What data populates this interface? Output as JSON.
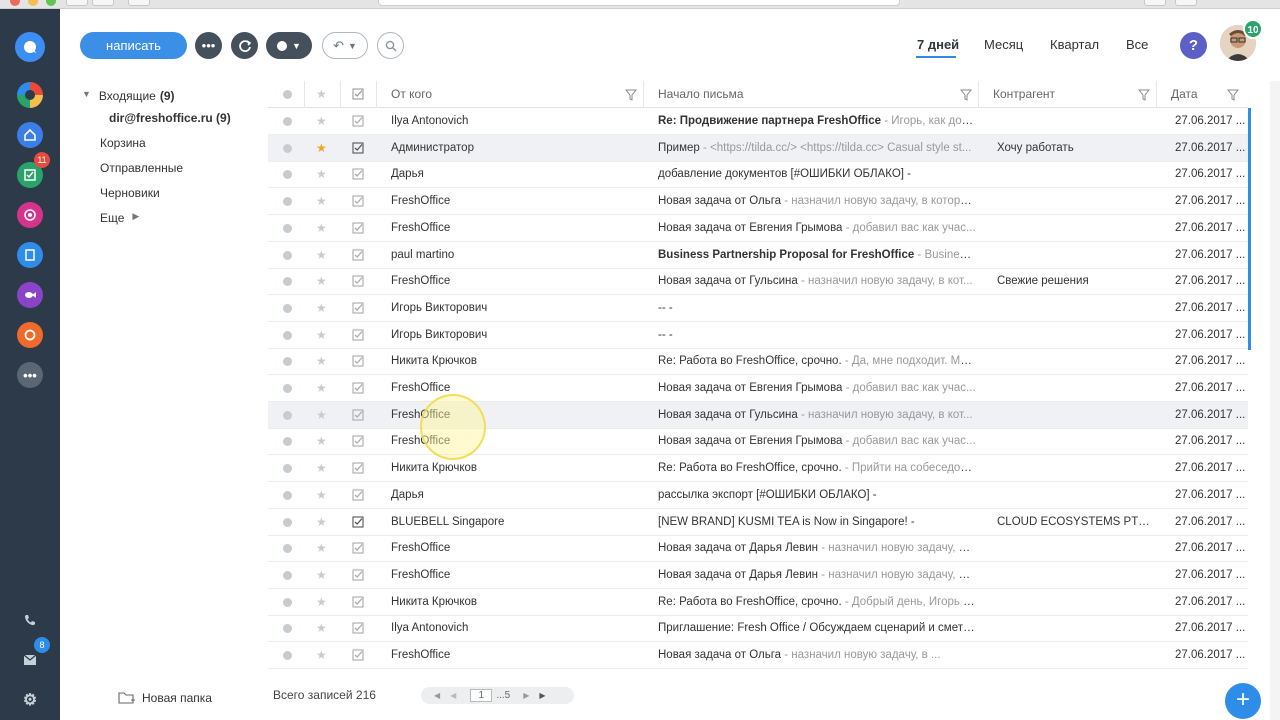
{
  "toolbar": {
    "compose_label": "написать",
    "periods": [
      "7 дней",
      "Месяц",
      "Квартал",
      "Все"
    ],
    "active_period": "7 дней",
    "help_label": "?",
    "avatar_badge": "10"
  },
  "rail": {
    "badges": {
      "tasks": "11",
      "mail": "8"
    }
  },
  "folders": {
    "inbox_label": "Входящие",
    "inbox_count": "(9)",
    "account": "dir@freshoffice.ru (9)",
    "trash": "Корзина",
    "sent": "Отправленные",
    "drafts": "Черновики",
    "more": "Еще",
    "new_folder": "Новая папка"
  },
  "table": {
    "headers": {
      "from": "От кого",
      "subject": "Начало письма",
      "contractor": "Контрагент",
      "date": "Дата"
    },
    "rows": [
      {
        "from": "Ilya Antonovich",
        "subject": "Re: Продвижение партнера FreshOffice",
        "preview": " - Игорь, как догов...",
        "contractor": "",
        "date": "27.06.2017 ...",
        "bold": true,
        "starred": false,
        "highlight": false,
        "checked": false
      },
      {
        "from": "Администратор",
        "subject": "Пример",
        "preview": " - <https://tilda.cc/> <https://tilda.cc> Casual style st...",
        "contractor": "Хочу работать",
        "date": "27.06.2017 ...",
        "bold": false,
        "starred": true,
        "highlight": true,
        "checked": true
      },
      {
        "from": "Дарья",
        "subject": "добавление документов [#ОШИБКИ ОБЛАКО] -",
        "preview": "",
        "contractor": "",
        "date": "27.06.2017 ...",
        "bold": false,
        "starred": false,
        "highlight": false,
        "checked": false
      },
      {
        "from": "FreshOffice",
        "subject": "Новая задача от Ольга",
        "preview": " - назначил новую задачу, в которо...",
        "contractor": "",
        "date": "27.06.2017 ...",
        "bold": false,
        "starred": false,
        "highlight": false,
        "checked": false
      },
      {
        "from": "FreshOffice",
        "subject": "Новая задача от Евгения Грымова",
        "preview": " - добавил вас как учас...",
        "contractor": "",
        "date": "27.06.2017 ...",
        "bold": false,
        "starred": false,
        "highlight": false,
        "checked": false
      },
      {
        "from": "paul martino",
        "subject": "Business Partnership Proposal for FreshOffice",
        "preview": " - Business P...",
        "contractor": "",
        "date": "27.06.2017 ...",
        "bold": true,
        "starred": false,
        "highlight": false,
        "checked": false
      },
      {
        "from": "FreshOffice",
        "subject": "Новая задача от Гульсина",
        "preview": " - назначил новую задачу, в кот...",
        "contractor": "Свежие решения",
        "date": "27.06.2017 ...",
        "bold": false,
        "starred": false,
        "highlight": false,
        "checked": false
      },
      {
        "from": "Игорь Викторович",
        "subject": "-- -",
        "preview": "",
        "contractor": "",
        "date": "27.06.2017 ...",
        "bold": false,
        "starred": false,
        "highlight": false,
        "checked": false
      },
      {
        "from": "Игорь Викторович",
        "subject": "-- -",
        "preview": "",
        "contractor": "",
        "date": "27.06.2017 ...",
        "bold": false,
        "starred": false,
        "highlight": false,
        "checked": false
      },
      {
        "from": "Никита Крючков",
        "subject": "Re: Работа во FreshOffice, срочно.",
        "preview": " - Да, мне подходит. Мой...",
        "contractor": "",
        "date": "27.06.2017 ...",
        "bold": false,
        "starred": false,
        "highlight": false,
        "checked": false
      },
      {
        "from": "FreshOffice",
        "subject": "Новая задача от Евгения Грымова",
        "preview": " - добавил вас как учас...",
        "contractor": "",
        "date": "27.06.2017 ...",
        "bold": false,
        "starred": false,
        "highlight": false,
        "checked": false
      },
      {
        "from": "FreshOffice",
        "subject": "Новая задача от Гульсина",
        "preview": " - назначил новую задачу, в кот...",
        "contractor": "",
        "date": "27.06.2017 ...",
        "bold": false,
        "starred": false,
        "highlight": true,
        "checked": false
      },
      {
        "from": "FreshOffice",
        "subject": "Новая задача от Евгения Грымова",
        "preview": " - добавил вас как учас...",
        "contractor": "",
        "date": "27.06.2017 ...",
        "bold": false,
        "starred": false,
        "highlight": false,
        "checked": false
      },
      {
        "from": "Никита Крючков",
        "subject": "Re: Работа во FreshOffice, срочно.",
        "preview": " - Прийти на собеседова...",
        "contractor": "",
        "date": "27.06.2017 ...",
        "bold": false,
        "starred": false,
        "highlight": false,
        "checked": false
      },
      {
        "from": "Дарья",
        "subject": "рассылка экспорт [#ОШИБКИ ОБЛАКО] -",
        "preview": "",
        "contractor": "",
        "date": "27.06.2017 ...",
        "bold": false,
        "starred": false,
        "highlight": false,
        "checked": false
      },
      {
        "from": "BLUEBELL Singapore",
        "subject": "[NEW BRAND] KUSMI TEA is Now in Singapore! -",
        "preview": "",
        "contractor": "CLOUD ECOSYSTEMS PTE LT...",
        "date": "27.06.2017 ...",
        "bold": false,
        "starred": false,
        "highlight": false,
        "checked": true
      },
      {
        "from": "FreshOffice",
        "subject": "Новая задача от Дарья Левин",
        "preview": " - назначил новую задачу, в ...",
        "contractor": "",
        "date": "27.06.2017 ...",
        "bold": false,
        "starred": false,
        "highlight": false,
        "checked": false
      },
      {
        "from": "FreshOffice",
        "subject": "Новая задача от Дарья Левин",
        "preview": " - назначил новую задачу, в ...",
        "contractor": "",
        "date": "27.06.2017 ...",
        "bold": false,
        "starred": false,
        "highlight": false,
        "checked": false
      },
      {
        "from": "Никита Крючков",
        "subject": "Re: Работа во FreshOffice, срочно.",
        "preview": " - Добрый день, Игорь В...",
        "contractor": "",
        "date": "27.06.2017 ...",
        "bold": false,
        "starred": false,
        "highlight": false,
        "checked": false
      },
      {
        "from": "Ilya Antonovich",
        "subject": "Приглашение: Fresh Office / Обсуждаем сценарий и смету ...",
        "preview": "",
        "contractor": "",
        "date": "27.06.2017 ...",
        "bold": false,
        "starred": false,
        "highlight": false,
        "checked": false
      },
      {
        "from": "FreshOffice",
        "subject": "Новая задача от Ольга",
        "preview": " - назначил новую задачу, в ...",
        "contractor": "",
        "date": "27.06.2017 ...",
        "bold": false,
        "starred": false,
        "highlight": false,
        "checked": false
      }
    ]
  },
  "footer": {
    "total_label": "Всего записей",
    "total_value": "216",
    "page_current": "1",
    "page_rest": "...5"
  },
  "fab_label": "+",
  "colors": {
    "accent": "#2e8de8",
    "rail": "#2c3a4a",
    "star": "#f2a51f",
    "badge_red": "#e84b3c",
    "help": "#5b5fc7",
    "avatar_badge": "#29a36a"
  }
}
